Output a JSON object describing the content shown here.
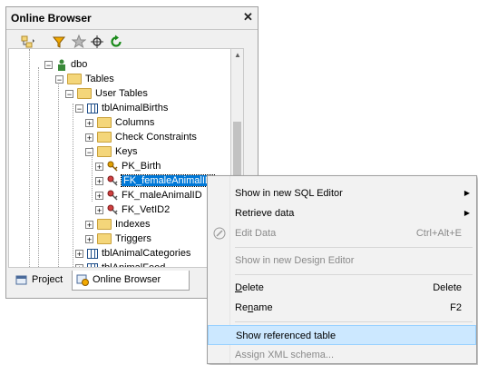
{
  "panel": {
    "title": "Online Browser",
    "close_glyph": "✕",
    "toolbar": [
      "add-object-icon",
      "filter-icon",
      "favorite-icon",
      "locate-icon",
      "refresh-icon"
    ]
  },
  "tree": {
    "dbo": "dbo",
    "tables": "Tables",
    "user_tables": "User Tables",
    "animal_births": "tblAnimalBirths",
    "columns": "Columns",
    "check_constraints": "Check Constraints",
    "keys": "Keys",
    "pk_birth": "PK_Birth",
    "fk_female": "FK_femaleAnimalID",
    "fk_male": "FK_maleAnimalID",
    "fk_vet": "FK_VetID2",
    "indexes": "Indexes",
    "triggers": "Triggers",
    "animal_categories": "tblAnimalCategories",
    "animal_feed": "tblAnimalFeed"
  },
  "tabs": {
    "project": "Project",
    "online_browser": "Online Browser"
  },
  "menu": {
    "show_sql": "Show in new SQL Editor",
    "retrieve": "Retrieve data",
    "edit_data": "Edit Data",
    "edit_data_shortcut": "Ctrl+Alt+E",
    "show_design": "Show in new Design Editor",
    "delete_first": "D",
    "delete_rest": "elete",
    "delete_shortcut": "Delete",
    "rename_first": "Re",
    "rename_u": "n",
    "rename_rest": "ame",
    "rename_shortcut": "F2",
    "show_ref": "Show referenced table",
    "assign_xml": "Assign XML schema..."
  }
}
